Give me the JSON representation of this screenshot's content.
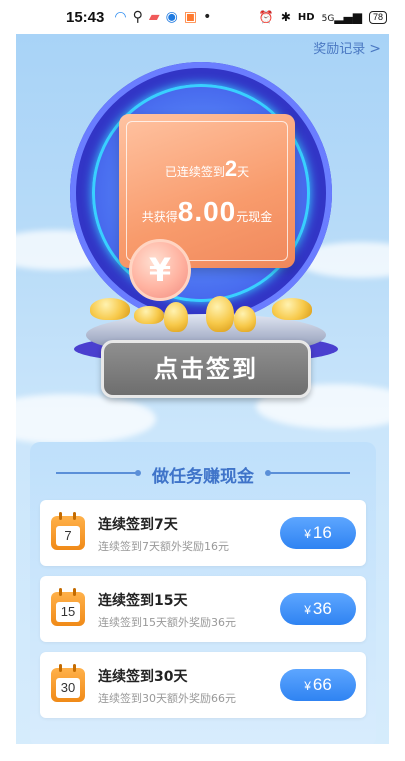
{
  "status_bar": {
    "time": "15:43",
    "network": "5G",
    "battery": "78"
  },
  "header": {
    "reward_record_label": "奖励记录",
    "chevron": ">"
  },
  "card": {
    "streak_prefix": "已连续签到",
    "streak_days": "2",
    "streak_suffix": "天",
    "earned_prefix": "共获得",
    "earned_amount": "8.00",
    "earned_suffix": "元现金"
  },
  "coin_symbol": "¥",
  "signin_button_label": "点击签到",
  "tasks_panel": {
    "title": "做任务赚现金",
    "tasks": [
      {
        "calendar": "7",
        "title": "连续签到7天",
        "subtitle": "连续签到7天额外奖励16元",
        "reward_currency": "¥",
        "reward_value": "16"
      },
      {
        "calendar": "15",
        "title": "连续签到15天",
        "subtitle": "连续签到15天额外奖励36元",
        "reward_currency": "¥",
        "reward_value": "36"
      },
      {
        "calendar": "30",
        "title": "连续签到30天",
        "subtitle": "连续签到30天额外奖励66元",
        "reward_currency": "¥",
        "reward_value": "66"
      }
    ]
  },
  "colors": {
    "accent_blue": "#2f83f2",
    "card_orange": "#f89b6c",
    "ring_blue": "#3c4bea"
  }
}
